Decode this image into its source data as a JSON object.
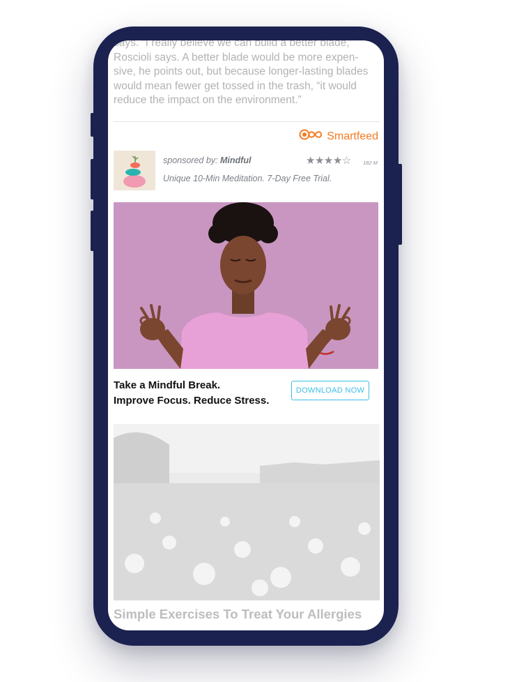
{
  "article": {
    "lines": [
      "says. “I really believe we can build a better blade,”",
      "Roscioli says. A better blade would be more expen-",
      "sive, he points out, but because longer-lasting blades",
      "would mean fewer get tossed in the trash, “it would",
      "reduce the impact on the environment.”"
    ]
  },
  "widget": {
    "brand_name": "Smartfeed",
    "brand_color": "#f57b20"
  },
  "sponsored_ad": {
    "sponsored_prefix": "sponsored by: ",
    "advertiser": "Mindful",
    "rating_stars": 4,
    "rating_max": 5,
    "stars_text": "★★★★☆",
    "rating_count": "182 M",
    "tagline": "Unique 10-Min Meditation. 7-Day Free Trial.",
    "headline_line1": "Take a Mindful Break.",
    "headline_line2": "Improve Focus. Reduce Stress.",
    "cta_label": "DOWNLOAD NOW",
    "cta_color": "#3bbde5"
  },
  "next_item": {
    "title": "Simple Exercises To Treat Your Allergies"
  }
}
